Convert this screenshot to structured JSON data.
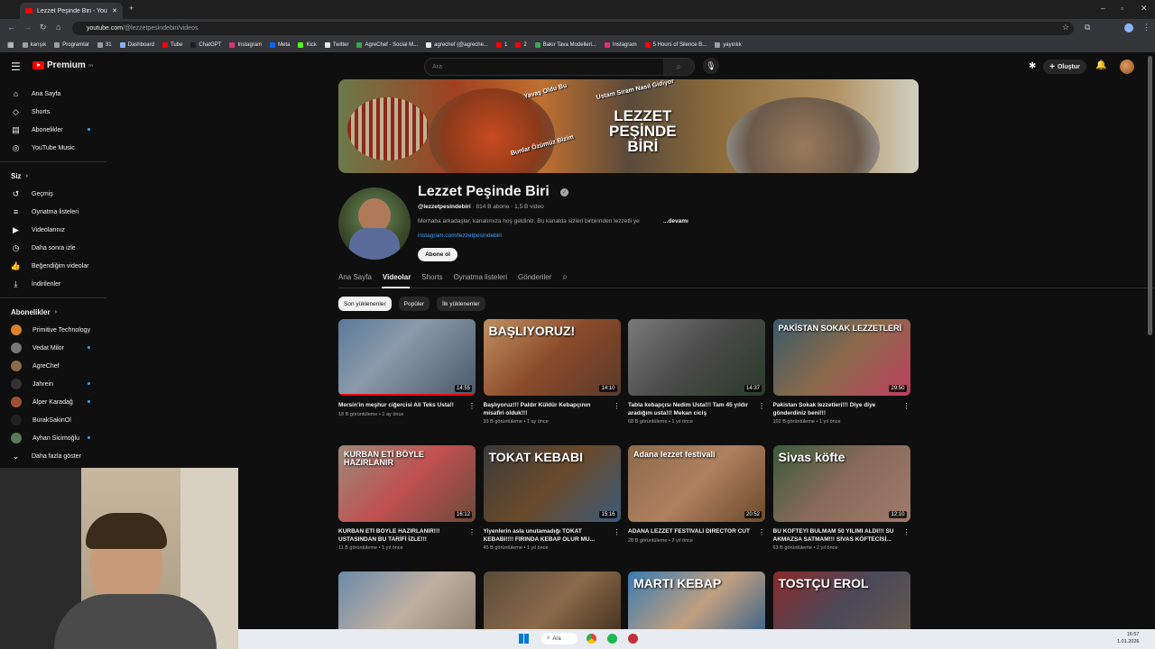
{
  "browser": {
    "tab_title": "Lezzet Peşinde Biri - YouTube",
    "url_host": "youtube.com",
    "url_path": "/@lezzetpesindebiri/videos",
    "bookmarks": [
      {
        "label": "karışık",
        "color": "#9aa0a6"
      },
      {
        "label": "Programlar",
        "color": "#9aa0a6"
      },
      {
        "label": "31",
        "color": "#9aa0a6"
      },
      {
        "label": "Dashboard",
        "color": "#8ab4f8"
      },
      {
        "label": "Tube",
        "color": "#ff0000"
      },
      {
        "label": "ChatGPT",
        "color": "#1f1f1f"
      },
      {
        "label": "Instagram",
        "color": "#e1306c"
      },
      {
        "label": "Meta",
        "color": "#0866ff"
      },
      {
        "label": "Kick",
        "color": "#53fc18"
      },
      {
        "label": "Twitter",
        "color": "#e8eaed"
      },
      {
        "label": "AgreChef - Social M...",
        "color": "#34a853"
      },
      {
        "label": "agrechef (@agreche...",
        "color": "#e8eaed"
      },
      {
        "label": "1",
        "color": "#ff0000"
      },
      {
        "label": "2",
        "color": "#ff0000"
      },
      {
        "label": "Bakır Tava Modelleri...",
        "color": "#34a853"
      },
      {
        "label": "Instagram",
        "color": "#e1306c"
      },
      {
        "label": "5 Hours of Silence B...",
        "color": "#ff0000"
      },
      {
        "label": "yayınlık",
        "color": "#9aa0a6"
      }
    ]
  },
  "header": {
    "logo_text": "Premium",
    "logo_sup": "TR",
    "search_placeholder": "Ara",
    "create_label": "Oluştur"
  },
  "sidebar": {
    "main": [
      {
        "label": "Ana Sayfa",
        "icon": "home-icon",
        "glyph": "⌂"
      },
      {
        "label": "Shorts",
        "icon": "shorts-icon",
        "glyph": "◇"
      },
      {
        "label": "Abonelikler",
        "icon": "subscriptions-icon",
        "glyph": "▤",
        "dot": true
      },
      {
        "label": "YouTube Music",
        "icon": "music-icon",
        "glyph": "◎"
      }
    ],
    "you_header": "Siz",
    "you": [
      {
        "label": "Geçmiş",
        "icon": "history-icon",
        "glyph": "↺"
      },
      {
        "label": "Oynatma listeleri",
        "icon": "playlists-icon",
        "glyph": "≡"
      },
      {
        "label": "Videolarınız",
        "icon": "your-videos-icon",
        "glyph": "▶"
      },
      {
        "label": "Daha sonra izle",
        "icon": "watch-later-icon",
        "glyph": "◷"
      },
      {
        "label": "Beğendiğim videolar",
        "icon": "liked-icon",
        "glyph": "👍"
      },
      {
        "label": "İndirilenler",
        "icon": "downloads-icon",
        "glyph": "⤓"
      }
    ],
    "subs_header": "Abonelikler",
    "subs": [
      {
        "label": "Primitive Technology",
        "color": "#d9822b",
        "dot": false
      },
      {
        "label": "Vedat Milor",
        "color": "#777",
        "dot": true
      },
      {
        "label": "AgreChef",
        "color": "#8a6a4a",
        "dot": false
      },
      {
        "label": "Jahrein",
        "color": "#333",
        "dot": true
      },
      {
        "label": "Alper Karadağ",
        "color": "#a05030",
        "dot": true
      },
      {
        "label": "BurakSakinOl",
        "color": "#222",
        "dot": false
      },
      {
        "label": "Ayhan Sicimoğlu",
        "color": "#5a7a5a",
        "dot": true
      }
    ],
    "show_more": "Daha fazla göster"
  },
  "banner": {
    "title_line1": "LEZZET",
    "title_line2": "PEŞİNDE",
    "title_line3": "BİRİ",
    "sticker1": "Yavaş Oldu Bu",
    "sticker2": "Ustam Sıram Nasıl Gidiyor",
    "sticker3": "Bunlar Özümüz Bizim"
  },
  "channel": {
    "name": "Lezzet Peşinde Biri",
    "handle": "@lezzetpesindebiri",
    "subscribers": "814 B abone",
    "videos": "1,5 B video",
    "description": "Merhaba arkadaşlar, kanalımıza hoş geldiniz. Bu kanalda sizleri birbirinden lezzetli ye",
    "more": "...devamı",
    "link": "instagram.com/lezzetpesindebiri",
    "subscribe": "Abone ol"
  },
  "tabs": [
    "Ana Sayfa",
    "Videolar",
    "Shorts",
    "Oynatma listeleri",
    "Gönderiler"
  ],
  "active_tab": "Videolar",
  "chips": [
    "Son yüklenenler",
    "Popüler",
    "İlk yüklenenler"
  ],
  "videos": [
    {
      "title": "Mersin'in meşhur ciğercisi Ali Teks Usta!!",
      "meta": "18 B görüntüleme • 1 ay önce",
      "duration": "14:55",
      "overlay": "",
      "bg": "linear-gradient(135deg,#5a7a9a,#8a9aaa 40%,#4a5a6a)"
    },
    {
      "title": "Başlıyoruz!!! Paldır Küldür Kebapçının misafiri olduk!!!",
      "meta": "33 B görüntüleme • 1 ay önce",
      "duration": "14:10",
      "overlay": "BAŞLIYORUZ!",
      "bg": "linear-gradient(135deg,#c09060,#8a4a2a 50%,#5a3a2a)"
    },
    {
      "title": "Tabla kebapçısı Nedim Usta!!! Tam 45 yıldır aradığım usta!!! Mekan ciciş",
      "meta": "68 B görüntüleme • 1 yıl önce",
      "duration": "14:37",
      "overlay": "",
      "bg": "linear-gradient(135deg,#7a7a7a,#4a4a4a 50%,#2a3a2a)"
    },
    {
      "title": "Pakistan Sokak lezzetleri!!! Diye diye gönderdiniz beni!!!",
      "meta": "102 B görüntüleme • 1 yıl önce",
      "duration": "29:50",
      "overlay": "PAKİSTAN SOKAK LEZZETLERİ",
      "bg": "linear-gradient(135deg,#3a5a6a,#8a6a4a 50%,#c04060)"
    },
    {
      "title": "KURBAN ETİ BÖYLE HAZIRLANIR!!! USTASINDAN BU TARİFİ İZLE!!!",
      "meta": "11 B görüntüleme • 1 yıl önce",
      "duration": "16:12",
      "overlay": "KURBAN ETİ BÖYLE HAZIRLANIR",
      "bg": "linear-gradient(135deg,#9a8a7a,#c05050 50%,#6a4a3a)"
    },
    {
      "title": "Yiyenlerin asla unutamadığı TOKAT KEBABI!!!! FIRINDA KEBAP OLUR MU...",
      "meta": "45 B görüntüleme • 1 yıl önce",
      "duration": "15:16",
      "overlay": "TOKAT KEBABI",
      "bg": "linear-gradient(135deg,#3a3a3a,#6a4a2a 50%,#3a5a7a)"
    },
    {
      "title": "ADANA LEZZET FESTİVALİ DIRECTOR CUT",
      "meta": "28 B görüntüleme • 2 yıl önce",
      "duration": "20:52",
      "overlay": "Adana lezzet festivali",
      "bg": "linear-gradient(135deg,#8a6a4a,#b08060 50%,#6a4a2a)"
    },
    {
      "title": "BU KÖFTEYİ BULMAM 50 YILIMI ALDI!!! SU AKMAZSA SATMAM!!! SİVAS KÖFTECİSİ...",
      "meta": "63 B görüntüleme • 2 yıl önce",
      "duration": "12:10",
      "overlay": "Sivas köfte",
      "bg": "linear-gradient(135deg,#3a5a3a,#8a6a5a 50%,#a07a6a)"
    },
    {
      "title": "",
      "meta": "",
      "duration": "",
      "overlay": "",
      "bg": "linear-gradient(135deg,#6a8aaa,#c0b0a0 50%,#8a7a6a)"
    },
    {
      "title": "",
      "meta": "",
      "duration": "",
      "overlay": "",
      "bg": "linear-gradient(135deg,#5a4a3a,#8a6a4a 50%,#3a2a1a)"
    },
    {
      "title": "",
      "meta": "",
      "duration": "",
      "overlay": "MARTI KEBAP",
      "bg": "linear-gradient(135deg,#3a7ab0,#c0a080 50%,#2a5a8a)"
    },
    {
      "title": "",
      "meta": "",
      "duration": "",
      "overlay": "TOSTÇU EROL",
      "bg": "linear-gradient(135deg,#8a2a2a,#4a4a5a 50%,#6a5a4a)"
    }
  ],
  "taskbar": {
    "search": "Ara",
    "time": "16:57",
    "date": "1.01.2026"
  }
}
